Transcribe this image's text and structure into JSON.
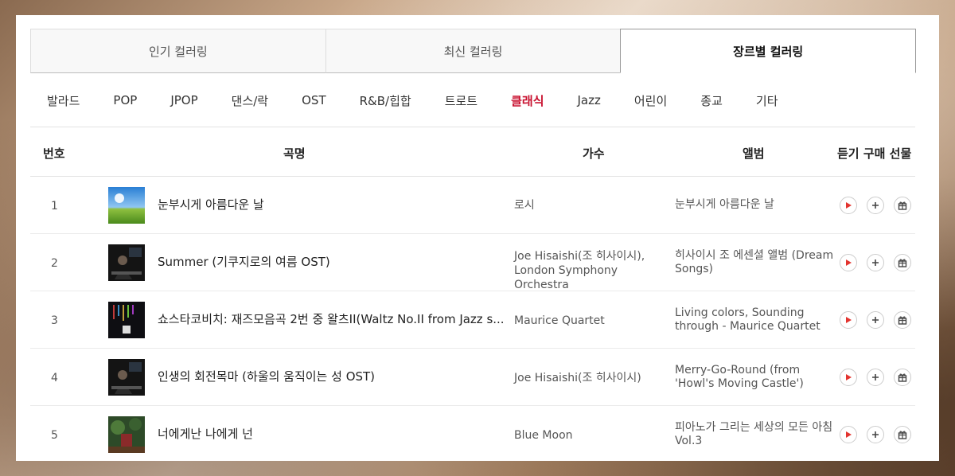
{
  "tabs": [
    {
      "label": "인기 컬러링"
    },
    {
      "label": "최신 컬러링"
    },
    {
      "label": "장르별 컬러링"
    }
  ],
  "active_tab": 2,
  "genres": [
    "발라드",
    "POP",
    "JPOP",
    "댄스/락",
    "OST",
    "R&B/힙합",
    "트로트",
    "클래식",
    "Jazz",
    "어린이",
    "종교",
    "기타"
  ],
  "active_genre": 7,
  "accent_color": "#c8102e",
  "table": {
    "headers": {
      "num": "번호",
      "title": "곡명",
      "artist": "가수",
      "album": "앨범",
      "actions": "듣기 구매 선물"
    },
    "rows": [
      {
        "num": "1",
        "title": "눈부시게 아름다운 날",
        "artist": "로시",
        "album": "눈부시게 아름다운 날",
        "thumb": "sky-field"
      },
      {
        "num": "2",
        "title": "Summer (기쿠지로의 여름 OST)",
        "artist": "Joe Hisaishi(조 히사이시), London Symphony Orchestra",
        "album": "히사이시 조 에센셜 앨범 (Dream Songs)",
        "thumb": "pianist-dark"
      },
      {
        "num": "3",
        "title": "쇼스타코비치: 재즈모음곡 2번 중 왈츠II(Waltz No.II from Jazz s...",
        "artist": "Maurice Quartet",
        "album": "Living colors, Sounding through - Maurice Quartet",
        "thumb": "quartet-dark"
      },
      {
        "num": "4",
        "title": "인생의 회전목마 (하울의 움직이는 성 OST)",
        "artist": "Joe Hisaishi(조 히사이시)",
        "album": "Merry-Go-Round (from 'Howl's Moving Castle')",
        "thumb": "pianist-dark"
      },
      {
        "num": "5",
        "title": "너에게난 나에게 넌",
        "artist": "Blue Moon",
        "album": "피아노가 그리는 세상의 모든 아침 Vol.3",
        "thumb": "forest-red"
      }
    ]
  },
  "icons": {
    "play": "play-icon",
    "buy": "plus-icon",
    "gift": "gift-icon"
  }
}
